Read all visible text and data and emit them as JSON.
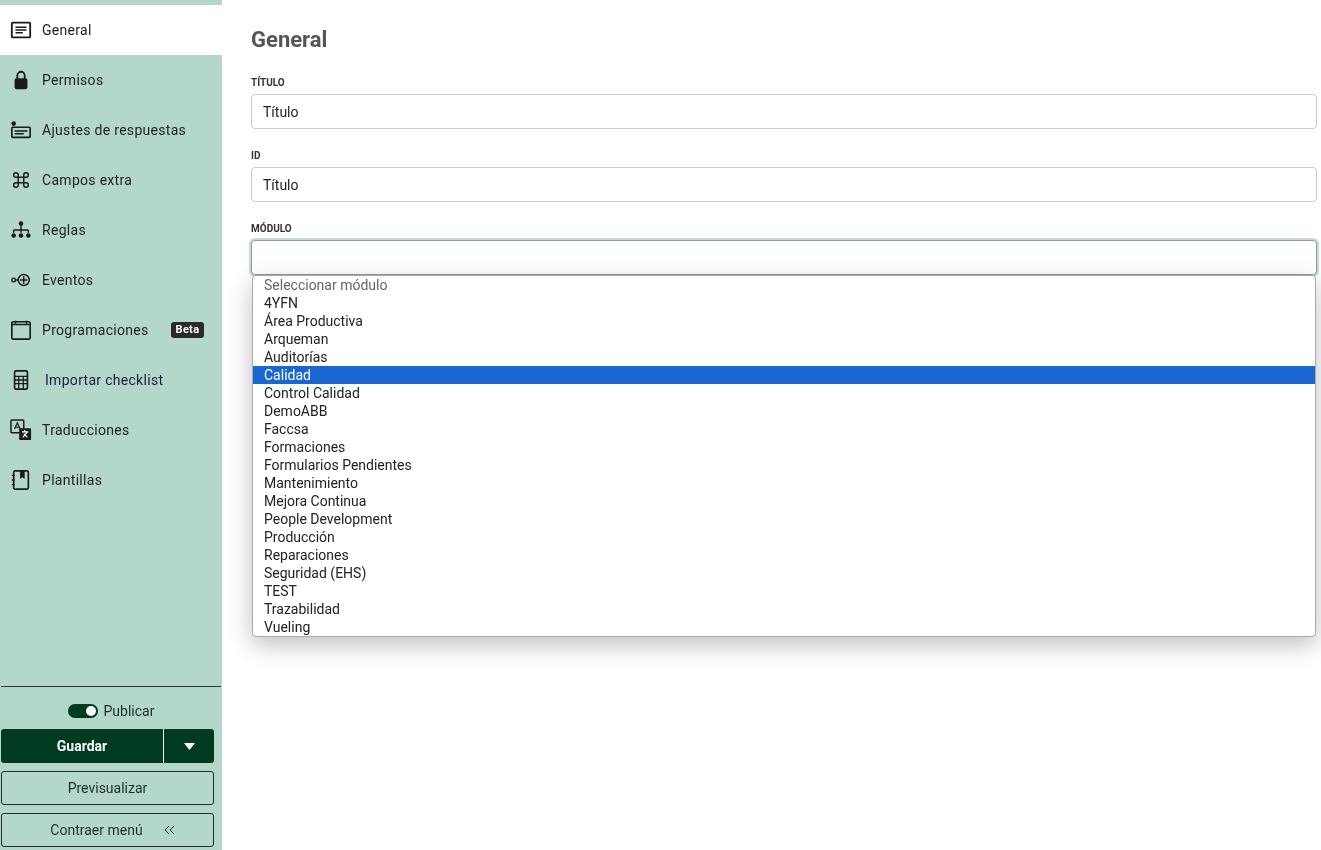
{
  "sidebar": {
    "items": [
      {
        "label": "General",
        "selected": true
      },
      {
        "label": "Permisos",
        "selected": false
      },
      {
        "label": "Ajustes de respuestas",
        "selected": false
      },
      {
        "label": "Campos extra",
        "selected": false
      },
      {
        "label": "Reglas",
        "selected": false
      },
      {
        "label": "Eventos",
        "selected": false
      },
      {
        "label": "Programaciones",
        "selected": false,
        "badge": "Beta"
      },
      {
        "label": "Importar checklist",
        "selected": false
      },
      {
        "label": "Traducciones",
        "selected": false
      },
      {
        "label": "Plantillas",
        "selected": false
      }
    ],
    "publish": {
      "label": "Publicar",
      "on": true
    },
    "save_button": "Guardar",
    "preview_button": "Previsualizar",
    "collapse_button": "Contraer menú"
  },
  "main": {
    "title": "General",
    "fields": [
      {
        "label": "TÍTULO",
        "value": "Título"
      },
      {
        "label": "ID",
        "value": "Título"
      },
      {
        "label": "MÓDULO",
        "expanded": true,
        "options": [
          {
            "label": "Seleccionar módulo",
            "selected": false,
            "kind": "hint"
          },
          {
            "label": "4YFN",
            "selected": false
          },
          {
            "label": "Área Productiva",
            "selected": false
          },
          {
            "label": "Arqueman",
            "selected": false
          },
          {
            "label": "Auditorías",
            "selected": false
          },
          {
            "label": "Calidad",
            "selected": true
          },
          {
            "label": "Control Calidad",
            "selected": false
          },
          {
            "label": "DemoABB",
            "selected": false
          },
          {
            "label": "Faccsa",
            "selected": false
          },
          {
            "label": "Formaciones",
            "selected": false
          },
          {
            "label": "Formularios Pendientes",
            "selected": false
          },
          {
            "label": "Mantenimiento",
            "selected": false
          },
          {
            "label": "Mejora Continua",
            "selected": false
          },
          {
            "label": "People Development",
            "selected": false
          },
          {
            "label": "Producción",
            "selected": false
          },
          {
            "label": "Reparaciones",
            "selected": false
          },
          {
            "label": "Seguridad (EHS)",
            "selected": false
          },
          {
            "label": "TEST",
            "selected": false
          },
          {
            "label": "Trazabilidad",
            "selected": false
          },
          {
            "label": "Vueling",
            "selected": false
          }
        ]
      }
    ]
  }
}
